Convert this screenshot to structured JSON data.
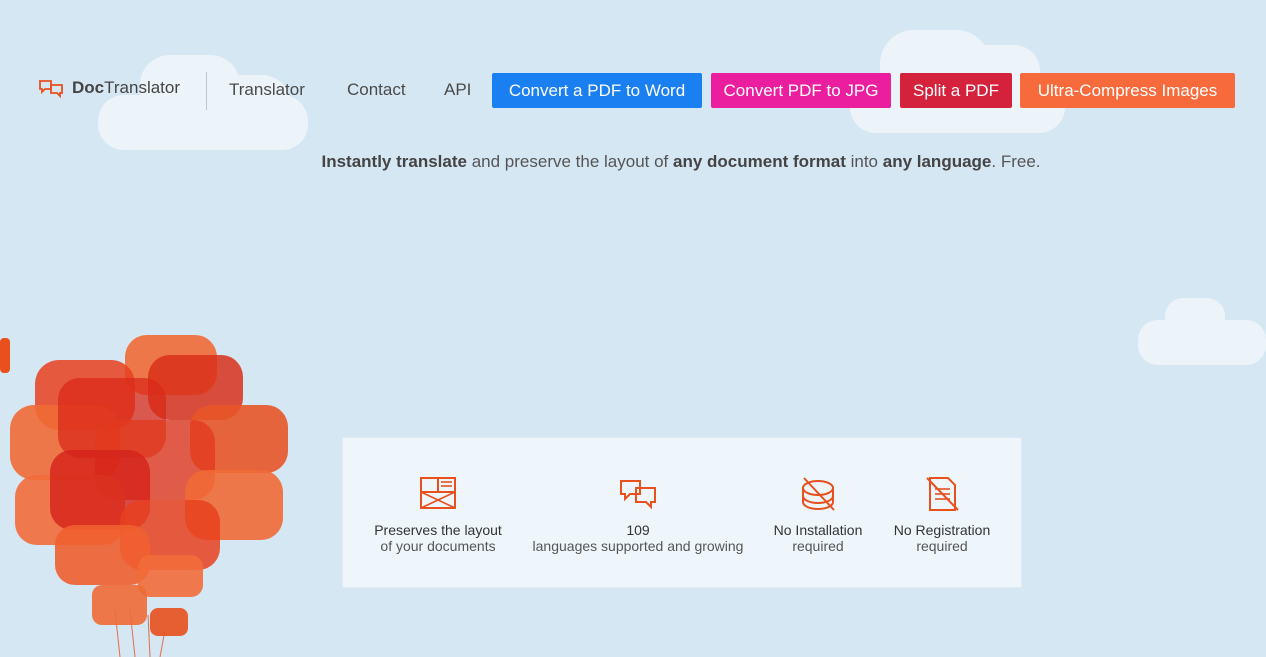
{
  "brand": {
    "name_bold": "Doc",
    "name_rest": "Translator"
  },
  "nav": {
    "links": [
      "Translator",
      "Contact",
      "API"
    ],
    "buttons": [
      {
        "label": "Convert a PDF to Word",
        "color": "#1a7ff0"
      },
      {
        "label": "Convert PDF to JPG",
        "color": "#ec1ea0"
      },
      {
        "label": "Split a PDF",
        "color": "#d5223c"
      },
      {
        "label": "Ultra-Compress Images",
        "color": "#f76a3c"
      }
    ]
  },
  "tagline": {
    "part1": "Instantly translate",
    "part2": " and preserve the layout of ",
    "part3": "any document format",
    "part4": " into ",
    "part5": "any language",
    "part6": ". Free."
  },
  "features": [
    {
      "icon": "document-layout-icon",
      "line1": "Preserves the layout",
      "line2": "of your documents"
    },
    {
      "icon": "translate-bubbles-icon",
      "line1": "109",
      "line2": "languages supported and growing"
    },
    {
      "icon": "no-installation-icon",
      "line1": "No Installation",
      "line2": "required"
    },
    {
      "icon": "no-registration-icon",
      "line1": "No Registration",
      "line2": "required"
    }
  ],
  "colors": {
    "accent": "#e8501e",
    "background": "#d6e7f4"
  }
}
